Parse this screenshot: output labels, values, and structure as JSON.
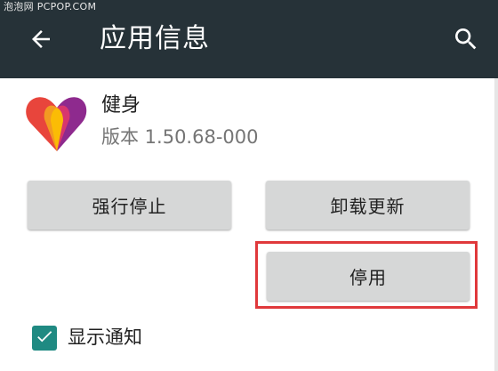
{
  "watermark": "泡泡网 PCPOP.COM",
  "appbar": {
    "back_icon": "arrow-left-icon",
    "title": "应用信息",
    "search_icon": "search-icon",
    "background_color": "#263238"
  },
  "app": {
    "name": "健身",
    "version": "版本 1.50.68-000",
    "icon": "google-fit-heart-icon"
  },
  "buttons": {
    "force_stop": "强行停止",
    "uninstall_updates": "卸载更新",
    "disable": "停用"
  },
  "highlight_color": "#e0383b",
  "notifications": {
    "checked": true,
    "label": "显示通知",
    "accent_color": "#1f8a82"
  }
}
